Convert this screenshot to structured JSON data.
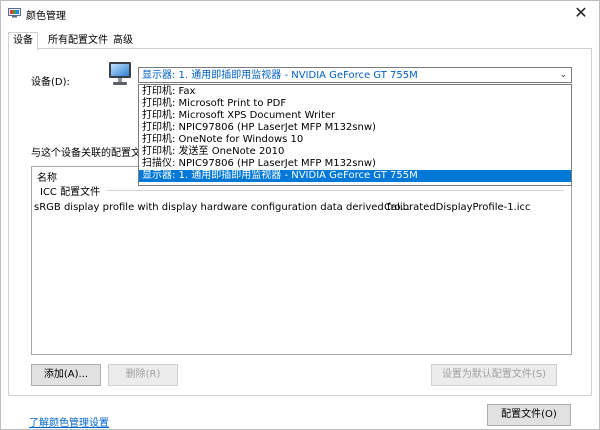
{
  "window": {
    "title": "颜色管理",
    "close_glyph": "✕"
  },
  "tabs": [
    {
      "label": "设备"
    },
    {
      "label": "所有配置文件"
    },
    {
      "label": "高级"
    }
  ],
  "devices_tab": {
    "device_label": "设备(D):",
    "selected_device": "显示器: 1. 通用即插即用监视器 - NVIDIA GeForce GT 755M",
    "dropdown_options": [
      "打印机: Fax",
      "打印机: Microsoft Print to PDF",
      "打印机: Microsoft XPS Document Writer",
      "打印机: NPIC97806 (HP LaserJet MFP M132snw)",
      "打印机: OneNote for Windows 10",
      "打印机: 发送至 OneNote 2010",
      "扫描仪: NPIC97806 (HP LaserJet MFP M132snw)",
      "显示器: 1. 通用即插即用监视器 - NVIDIA GeForce GT 755M"
    ],
    "associated_label": "与这个设备关联的配置文件",
    "list": {
      "column_name": "名称",
      "group_header": "ICC 配置文件",
      "rows": [
        {
          "description": "sRGB display profile with display hardware configuration data derived fro...",
          "file": "CalibratedDisplayProfile-1.icc"
        }
      ]
    },
    "buttons": {
      "add": "添加(A)...",
      "remove": "删除(R)",
      "set_default": "设置为默认配置文件(S)"
    }
  },
  "footer": {
    "link": "了解颜色管理设置",
    "profiles_button": "配置文件(O)"
  },
  "colors": {
    "selection": "#0078d7",
    "link": "#0066cc"
  }
}
